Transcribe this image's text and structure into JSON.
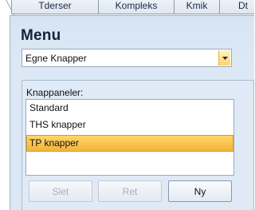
{
  "tabs": [
    {
      "label": "Tderser"
    },
    {
      "label": "Kompleks"
    },
    {
      "label": "Kmik"
    },
    {
      "label": "Dt"
    }
  ],
  "panel": {
    "title": "Menu",
    "menu_select": {
      "value": "Egne Knapper"
    },
    "group": {
      "label": "Knappaneler:",
      "items": [
        {
          "label": "Standard",
          "selected": false
        },
        {
          "label": "THS knapper",
          "selected": false
        },
        {
          "label": "TP knapper",
          "selected": true
        }
      ],
      "buttons": {
        "delete_label": "Slet",
        "edit_label": "Ret",
        "new_label": "Ny"
      }
    }
  },
  "colors": {
    "selection_top": "#ffd568",
    "selection_bottom": "#f3b43c",
    "panel_bg": "#dce8f5"
  }
}
